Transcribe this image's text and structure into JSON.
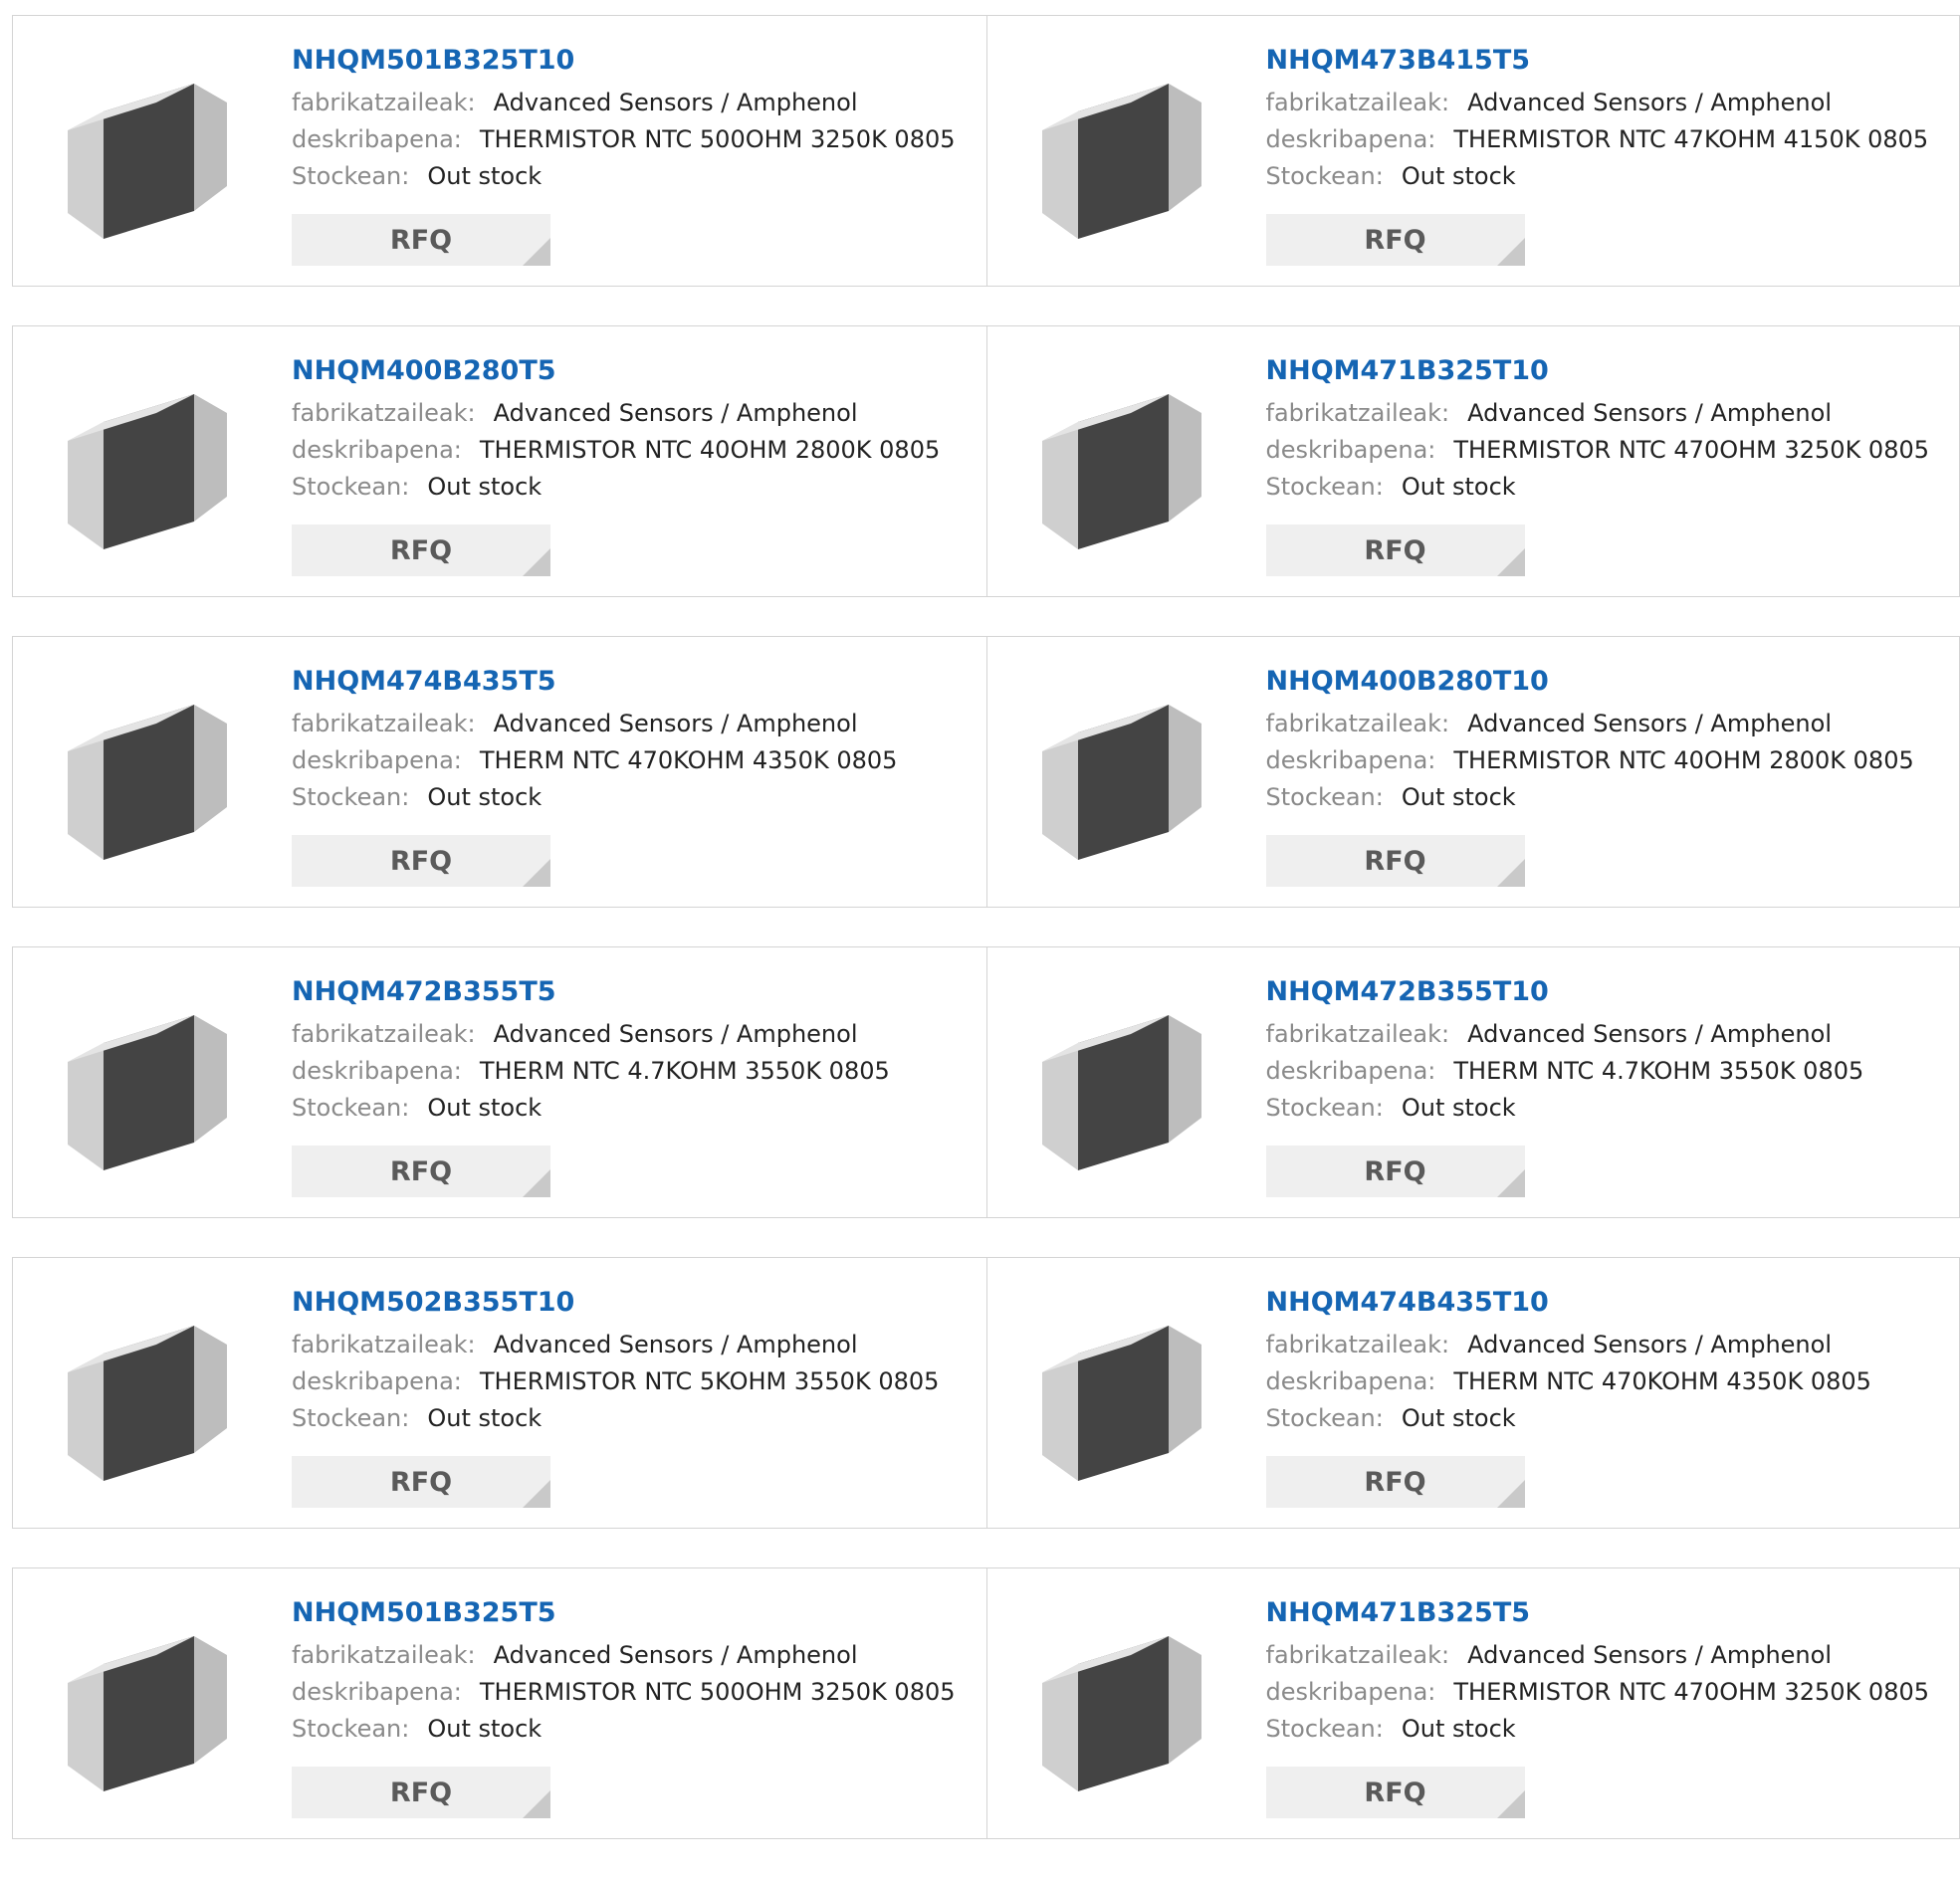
{
  "labels": {
    "manufacturer": "fabrikatzaileak:",
    "description": "deskribapena:",
    "stock": "Stockean:"
  },
  "colors": {
    "part_link": "#1565b3",
    "label": "#8a8a8a",
    "value": "#222222",
    "rfq_background": "#efefef",
    "rfq_corner": "#c9c9c9",
    "card_border": "#d4d4d4"
  },
  "products": [
    {
      "part": "NHQM501B325T10",
      "manufacturer": "Advanced Sensors / Amphenol",
      "description": "THERMISTOR NTC 500OHM 3250K 0805",
      "stock": "Out stock",
      "button": "RFQ"
    },
    {
      "part": "NHQM473B415T5",
      "manufacturer": "Advanced Sensors / Amphenol",
      "description": "THERMISTOR NTC 47KOHM 4150K 0805",
      "stock": "Out stock",
      "button": "RFQ"
    },
    {
      "part": "NHQM400B280T5",
      "manufacturer": "Advanced Sensors / Amphenol",
      "description": "THERMISTOR NTC 40OHM 2800K 0805",
      "stock": "Out stock",
      "button": "RFQ"
    },
    {
      "part": "NHQM471B325T10",
      "manufacturer": "Advanced Sensors / Amphenol",
      "description": "THERMISTOR NTC 470OHM 3250K 0805",
      "stock": "Out stock",
      "button": "RFQ"
    },
    {
      "part": "NHQM474B435T5",
      "manufacturer": "Advanced Sensors / Amphenol",
      "description": "THERM NTC 470KOHM 4350K 0805",
      "stock": "Out stock",
      "button": "RFQ"
    },
    {
      "part": "NHQM400B280T10",
      "manufacturer": "Advanced Sensors / Amphenol",
      "description": "THERMISTOR NTC 40OHM 2800K 0805",
      "stock": "Out stock",
      "button": "RFQ"
    },
    {
      "part": "NHQM472B355T5",
      "manufacturer": "Advanced Sensors / Amphenol",
      "description": "THERM NTC 4.7KOHM 3550K 0805",
      "stock": "Out stock",
      "button": "RFQ"
    },
    {
      "part": "NHQM472B355T10",
      "manufacturer": "Advanced Sensors / Amphenol",
      "description": "THERM NTC 4.7KOHM 3550K 0805",
      "stock": "Out stock",
      "button": "RFQ"
    },
    {
      "part": "NHQM502B355T10",
      "manufacturer": "Advanced Sensors / Amphenol",
      "description": "THERMISTOR NTC 5KOHM 3550K 0805",
      "stock": "Out stock",
      "button": "RFQ"
    },
    {
      "part": "NHQM474B435T10",
      "manufacturer": "Advanced Sensors / Amphenol",
      "description": "THERM NTC 470KOHM 4350K 0805",
      "stock": "Out stock",
      "button": "RFQ"
    },
    {
      "part": "NHQM501B325T5",
      "manufacturer": "Advanced Sensors / Amphenol",
      "description": "THERMISTOR NTC 500OHM 3250K 0805",
      "stock": "Out stock",
      "button": "RFQ"
    },
    {
      "part": "NHQM471B325T5",
      "manufacturer": "Advanced Sensors / Amphenol",
      "description": "THERMISTOR NTC 470OHM 3250K 0805",
      "stock": "Out stock",
      "button": "RFQ"
    }
  ]
}
